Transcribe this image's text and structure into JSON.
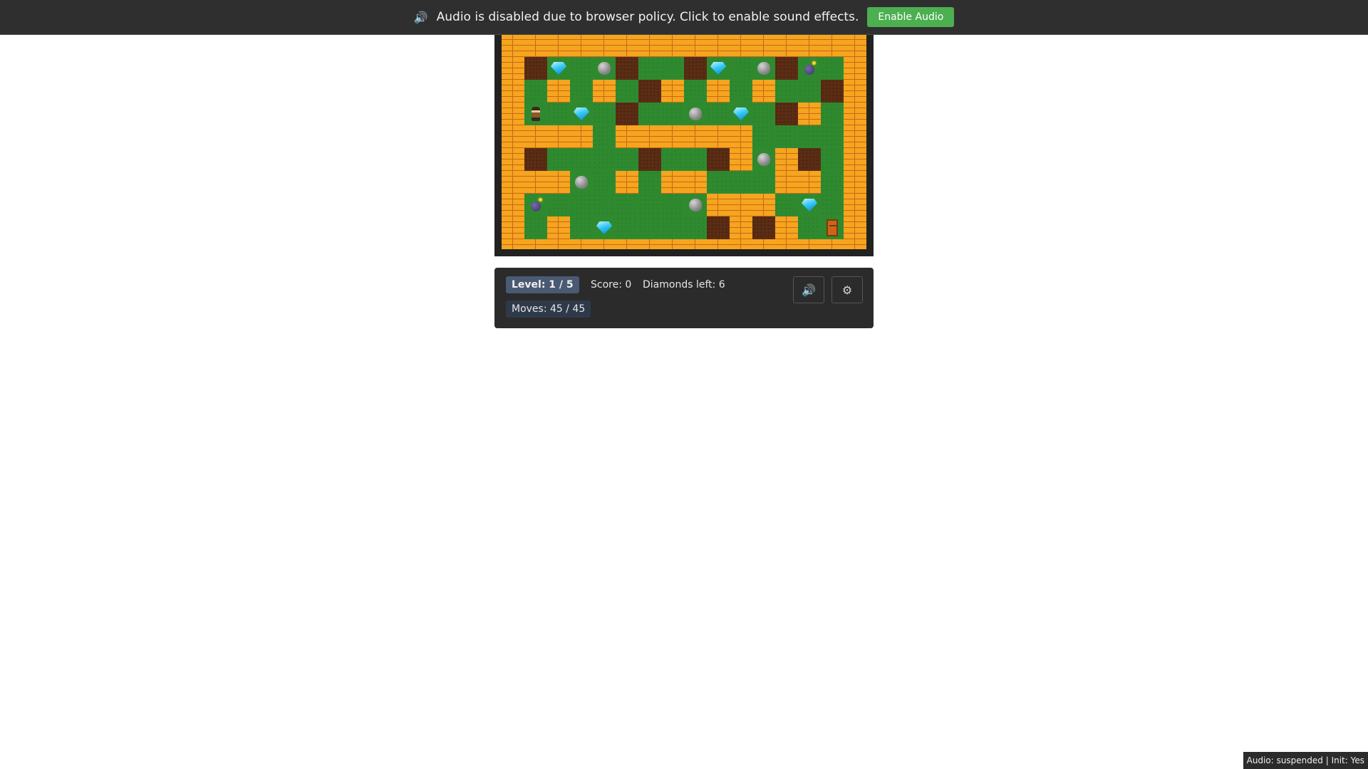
{
  "banner": {
    "speaker_icon": "🔊",
    "message": "Audio is disabled due to browser policy. Click to enable sound effects.",
    "button_label": "Enable Audio",
    "button_color": "#4caf50"
  },
  "game": {
    "tile_legend": {
      "W": "brick-wall",
      "G": "grass",
      "D": "dirt",
      "d": "diamond",
      "R": "rock",
      "B": "bomb",
      "P": "player",
      "E": "exit-door"
    },
    "grid": [
      "WWWWWWWWWWWWWWWW",
      "WDdGRDGGDdGRDBGW",
      "WGWGWGDWGWGWGGDW",
      "WPGdGDGGRGdGDWGW",
      "WWWWGWWWWWWGGGGW",
      "WDGGGGDGGDWRWDGW",
      "WWWRGWGWWGGGWWGW",
      "WBGGGGGGRWWWGdGW",
      "WGWGdGGGGDWDWGEW",
      "WWWWWWWWWWWWWWWW"
    ]
  },
  "hud": {
    "level": "Level: 1 / 5",
    "score": "Score: 0",
    "diamonds_left": "Diamonds left: 6",
    "moves": "Moves: 45 / 45",
    "sound_icon": "🔊",
    "settings_icon": "⚙"
  },
  "status": {
    "text": "Audio: suspended | Init: Yes"
  }
}
